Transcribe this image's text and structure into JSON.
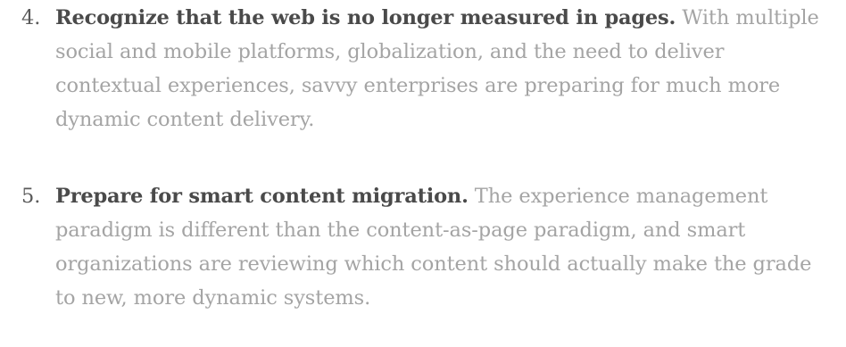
{
  "list": {
    "items": [
      {
        "number": "4.",
        "lead": "Recognize that the web is no longer measured in pages.",
        "text": " With multiple social and mobile platforms, globalization, and the need to deliver contextual experiences, savvy enterprises are preparing for much more dynamic content delivery."
      },
      {
        "number": "5.",
        "lead": "Prepare for smart content migration.",
        "text": " The experience management paradigm is different than the content-as-page paradigm, and smart organizations are reviewing which content should actually make the grade to new, more dynamic systems."
      }
    ]
  }
}
